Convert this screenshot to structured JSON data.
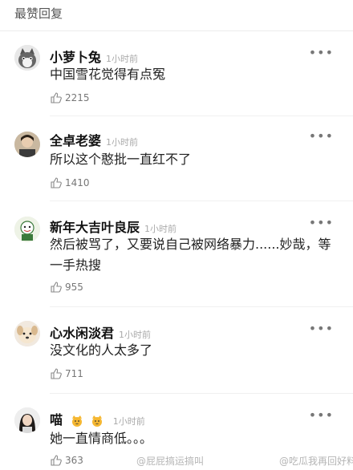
{
  "section": {
    "title": "最赞回复"
  },
  "comments": [
    {
      "user": "小萝卜兔",
      "time": "1小时前",
      "text": "中国雪花觉得有点冤",
      "likes": "2215",
      "avatar_icon": "cat-avatar-icon"
    },
    {
      "user": "全卓老婆",
      "time": "1小时前",
      "text": "所以这个憨批一直红不了",
      "likes": "1410",
      "avatar_icon": "person-avatar-icon"
    },
    {
      "user": "新年大吉叶良辰",
      "time": "1小时前",
      "text": "然后被骂了，又要说自己被网络暴力......妙哉，等一手热搜",
      "likes": "955",
      "avatar_icon": "cartoon-avatar-icon"
    },
    {
      "user": "心水闲淡君",
      "time": "1小时前",
      "text": "没文化的人太多了",
      "likes": "711",
      "avatar_icon": "dog-avatar-icon"
    },
    {
      "user": "喵",
      "time": "1小时前",
      "text": "她一直情商低。。。",
      "likes": "363",
      "avatar_icon": "girl-avatar-icon"
    }
  ],
  "more_label": "•••",
  "watermarks": {
    "left": "@屁屁搞运搞叫",
    "right": "@吃瓜我再回好料"
  },
  "colors": {
    "background": "#ffffff",
    "muted": "#aaaaaa",
    "text": "#222222"
  }
}
